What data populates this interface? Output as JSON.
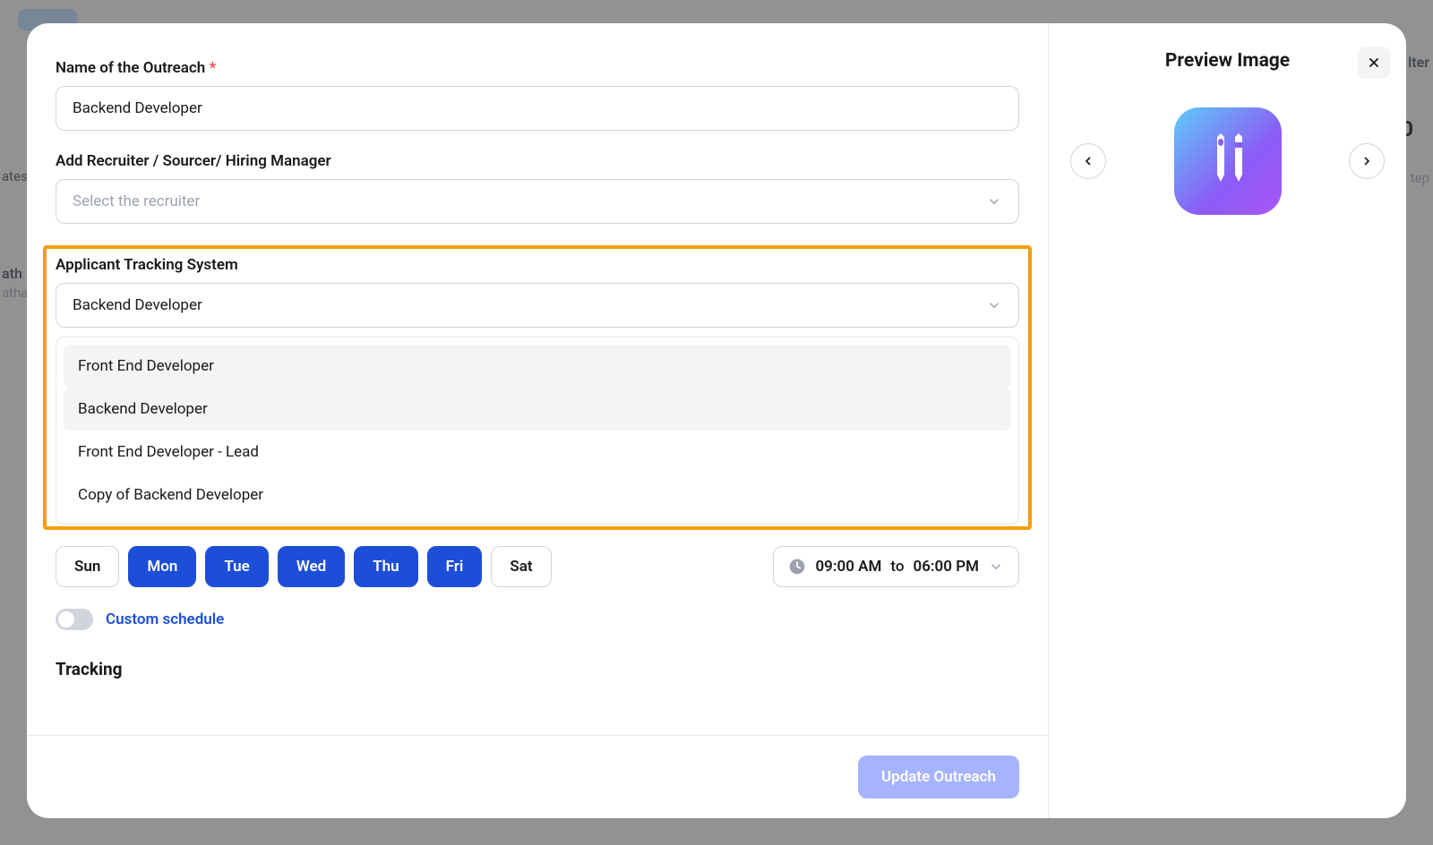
{
  "background": {
    "label_ates": "ates",
    "label_ath": "ath",
    "label_atha": "atha",
    "filter_label": "lter",
    "step_label": "tep",
    "count": "0"
  },
  "form": {
    "name_label": "Name of the Outreach",
    "name_value": "Backend Developer",
    "recruiter_label": "Add Recruiter / Sourcer/ Hiring Manager",
    "recruiter_placeholder": "Select the recruiter",
    "ats_label": "Applicant Tracking System",
    "ats_value": "Backend Developer",
    "ats_options": {
      "opt0": "Front End Developer",
      "opt1": "Backend Developer",
      "opt2": "Front End Developer - Lead",
      "opt3": "Copy of Backend Developer"
    }
  },
  "schedule": {
    "days": {
      "sun": "Sun",
      "mon": "Mon",
      "tue": "Tue",
      "wed": "Wed",
      "thu": "Thu",
      "fri": "Fri",
      "sat": "Sat"
    },
    "time_from": "09:00 AM",
    "time_to_label": "to",
    "time_to": "06:00 PM",
    "custom_label": "Custom schedule"
  },
  "tracking": {
    "title": "Tracking"
  },
  "footer": {
    "update_label": "Update Outreach"
  },
  "preview": {
    "title": "Preview Image"
  }
}
